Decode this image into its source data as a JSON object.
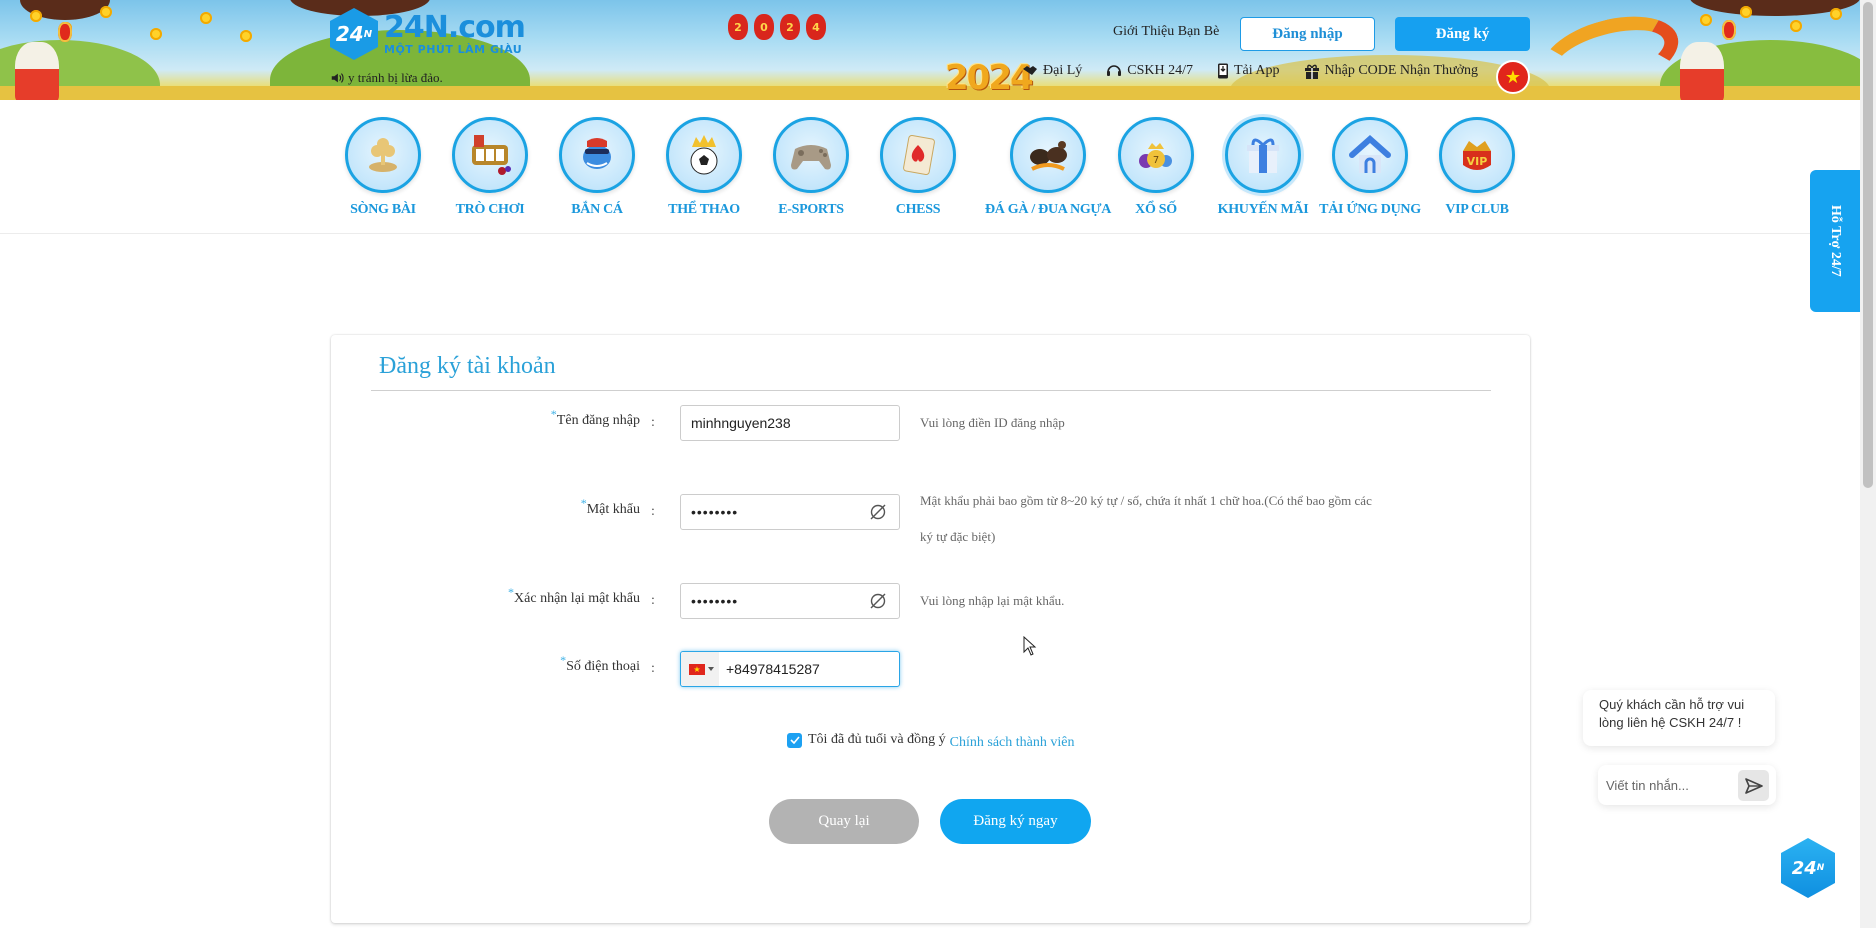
{
  "header": {
    "logo_mark": "24",
    "logo_mark_sup": "N",
    "logo_name": "24N.com",
    "logo_slogan": "MỘT PHÚT LÀM GIÀU",
    "marquee_text": "y tránh bị lừa đảo.",
    "year_badge": "2024",
    "lantern_chars": [
      "2",
      "0",
      "2",
      "4"
    ],
    "invite_label": "Giới Thiệu Bạn Bè",
    "login_label": "Đăng nhập",
    "register_label": "Đăng ký",
    "links": [
      {
        "label": "Đại Lý",
        "icon": "handshake-icon"
      },
      {
        "label": "CSKH 24/7",
        "icon": "headset-icon"
      },
      {
        "label": "Tải App",
        "icon": "phone-download-icon"
      },
      {
        "label": "Nhập CODE Nhận Thưởng",
        "icon": "gift-icon"
      }
    ],
    "language_flag": "vietnam-flag",
    "colors": {
      "brand": "#1b8fdc",
      "accent": "#16a0f0"
    }
  },
  "nav": {
    "items": [
      {
        "label": "SÒNG BÀI",
        "icon": "casino-chip-icon"
      },
      {
        "label": "TRÒ CHƠI",
        "icon": "slot-machine-icon"
      },
      {
        "label": "BẮN CÁ",
        "icon": "fish-icon"
      },
      {
        "label": "THỂ THAO",
        "icon": "soccer-ball-icon"
      },
      {
        "label": "E-SPORTS",
        "icon": "gamepad-icon"
      },
      {
        "label": "CHESS",
        "icon": "playing-card-icon"
      },
      {
        "label": "ĐÁ GÀ / ĐUA NGỰA",
        "icon": "rooster-icon"
      },
      {
        "label": "XỔ SỐ",
        "icon": "lottery-ball-icon"
      },
      {
        "label": "KHUYẾN MÃI",
        "icon": "gift-box-icon"
      },
      {
        "label": "TẢI ỨNG DỤNG",
        "icon": "home-icon"
      },
      {
        "label": "VIP CLUB",
        "icon": "vip-crown-icon"
      }
    ]
  },
  "form": {
    "title": "Đăng ký tài khoản",
    "required_mark": "*",
    "colon": ":",
    "fields": {
      "username": {
        "label": "Tên đăng nhập",
        "value": "minhnguyen238",
        "hint": "Vui lòng điền ID đăng nhập"
      },
      "password": {
        "label": "Mật khẩu",
        "value": "12345678",
        "hint_line1": "Mật khẩu phải bao gồm từ 8~20 ký tự / số, chứa ít nhất 1 chữ hoa.(Có thể bao gồm các",
        "hint_line2": "ký tự đặc biệt)"
      },
      "confirm": {
        "label": "Xác nhận lại mật khẩu",
        "value": "12345678",
        "hint": "Vui lòng nhập lại mật khẩu."
      },
      "phone": {
        "label": "Số điện thoại",
        "value": "+84978415287",
        "country": "VN"
      }
    },
    "agree_text": "Tôi đã đủ tuổi và đồng ý",
    "agree_link": "Chính sách thành viên",
    "agree_checked": true,
    "back_label": "Quay lại",
    "submit_label": "Đăng ký ngay"
  },
  "support_tab": {
    "label": "Hỗ Trợ 24/7"
  },
  "chat": {
    "message": "Quý khách cần hỗ trợ vui lòng liên hệ CSKH 24/7 !",
    "input_placeholder": "Viết tin nhắn...",
    "launcher_mark": "24",
    "launcher_sup": "N"
  }
}
